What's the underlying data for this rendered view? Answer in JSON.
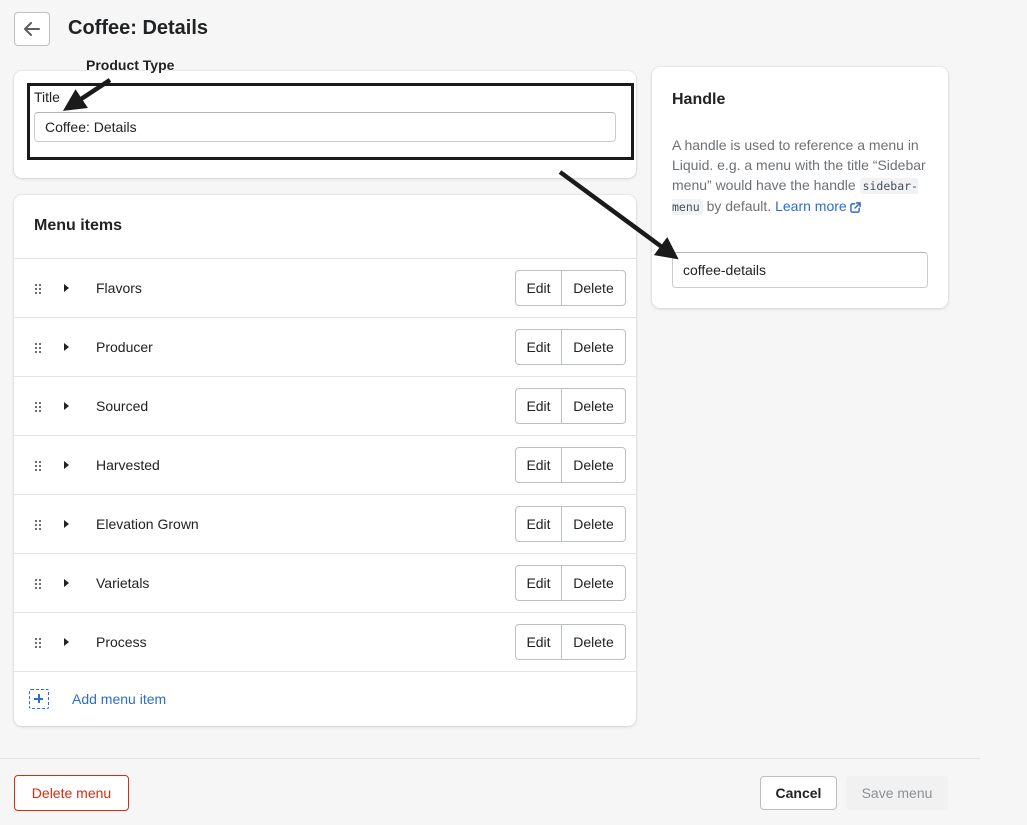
{
  "header": {
    "title": "Coffee: Details",
    "back_icon": "arrow-left-icon"
  },
  "annotation": {
    "label": "Product Type"
  },
  "title_card": {
    "label": "Title",
    "value": "Coffee: Details"
  },
  "menu": {
    "heading": "Menu items",
    "items": [
      {
        "label": "Flavors"
      },
      {
        "label": "Producer"
      },
      {
        "label": "Sourced"
      },
      {
        "label": "Harvested"
      },
      {
        "label": "Elevation Grown"
      },
      {
        "label": "Varietals"
      },
      {
        "label": "Process"
      }
    ],
    "edit_label": "Edit",
    "delete_label": "Delete",
    "add_label": "Add menu item"
  },
  "handle": {
    "heading": "Handle",
    "help_text_1": "A handle is used to reference a menu in Liquid. e.g. a menu with the title “Sidebar menu” would have the handle",
    "code": "sidebar-menu",
    "help_text_2": "by default.",
    "learn_more": "Learn more",
    "value": "coffee-details"
  },
  "footer": {
    "delete_menu": "Delete menu",
    "cancel": "Cancel",
    "save": "Save menu"
  },
  "colors": {
    "accent": "#2c6ecb",
    "critical": "#d72c0d",
    "annotation": "#1a1a1a"
  }
}
